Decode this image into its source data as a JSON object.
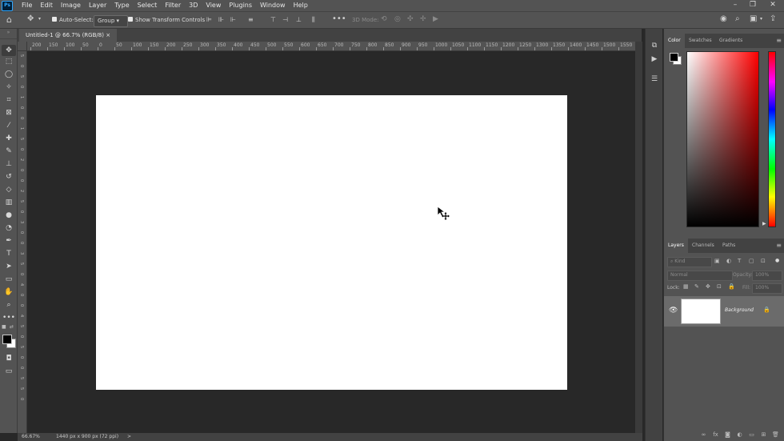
{
  "app": {
    "logo_text": "Ps"
  },
  "menubar": {
    "items": [
      "File",
      "Edit",
      "Image",
      "Layer",
      "Type",
      "Select",
      "Filter",
      "3D",
      "View",
      "Plugins",
      "Window",
      "Help"
    ],
    "window_controls": [
      "–",
      "❐",
      "✕"
    ]
  },
  "options": {
    "auto_select_label": "Auto-Select:",
    "auto_select_value": "Group",
    "show_transform_label": "Show Transform Controls",
    "mode_3d_label": "3D Mode:"
  },
  "document": {
    "tab_title": "Untitled-1 @ 66.7% (RGB/8)",
    "tab_close": "×",
    "ruler_labels": [
      "200",
      "150",
      "100",
      "50",
      "0",
      "50",
      "100",
      "150",
      "200",
      "250",
      "300",
      "350",
      "400",
      "450",
      "500",
      "550",
      "600",
      "650",
      "700",
      "750",
      "800",
      "850",
      "900",
      "950",
      "1000",
      "1050",
      "1100",
      "1150",
      "1200",
      "1250",
      "1300",
      "1350",
      "1400",
      "1450",
      "1500",
      "1550"
    ],
    "ruler_v_labels": [
      "5",
      "0",
      "5",
      "0",
      "1",
      "0",
      "0",
      "1",
      "5",
      "0",
      "2",
      "0",
      "0",
      "2",
      "5",
      "0",
      "3",
      "0",
      "0",
      "3",
      "5",
      "0",
      "4",
      "0",
      "0",
      "4",
      "5",
      "0",
      "5",
      "0",
      "0",
      "5",
      "5",
      "0"
    ]
  },
  "status": {
    "zoom": "66.67%",
    "doc_info": "1440 px x 900 px (72 ppi)",
    "arrow": ">"
  },
  "color_panel": {
    "tabs": [
      "Color",
      "Swatches",
      "Gradients"
    ],
    "active_tab": "Color",
    "fg_color": "#000000",
    "bg_color": "#ffffff",
    "hue_color": "#ff0000"
  },
  "layers_panel": {
    "tabs": [
      "Layers",
      "Channels",
      "Paths"
    ],
    "active_tab": "Layers",
    "search_placeholder": "Kind",
    "blend_mode": "Normal",
    "opacity_label": "Opacity:",
    "opacity_value": "100%",
    "lock_label": "Lock:",
    "fill_label": "Fill:",
    "fill_value": "100%",
    "layers": [
      {
        "name": "Background",
        "visible": true,
        "locked": true
      }
    ],
    "footer_icons": [
      "link-icon",
      "fx-icon",
      "mask-icon",
      "adjustment-icon",
      "group-icon",
      "new-layer-icon",
      "trash-icon"
    ],
    "footer_glyphs": [
      "∞",
      "fx",
      "◙",
      "◐",
      "▭",
      "⊞",
      "🗑"
    ]
  },
  "toolbar": {
    "tools": [
      {
        "name": "move-tool-icon",
        "glyph": "✥",
        "active": true
      },
      {
        "name": "marquee-tool-icon",
        "glyph": "⬚"
      },
      {
        "name": "lasso-tool-icon",
        "glyph": "◯"
      },
      {
        "name": "magic-wand-tool-icon",
        "glyph": "✧"
      },
      {
        "name": "crop-tool-icon",
        "glyph": "⌗"
      },
      {
        "name": "frame-tool-icon",
        "glyph": "⊠"
      },
      {
        "name": "eyedropper-tool-icon",
        "glyph": "⁄"
      },
      {
        "name": "healing-brush-tool-icon",
        "glyph": "✚"
      },
      {
        "name": "brush-tool-icon",
        "glyph": "✎"
      },
      {
        "name": "clone-stamp-tool-icon",
        "glyph": "⊥"
      },
      {
        "name": "history-brush-tool-icon",
        "glyph": "↺"
      },
      {
        "name": "eraser-tool-icon",
        "glyph": "◇"
      },
      {
        "name": "gradient-tool-icon",
        "glyph": "▥"
      },
      {
        "name": "blur-tool-icon",
        "glyph": "●"
      },
      {
        "name": "dodge-tool-icon",
        "glyph": "◔"
      },
      {
        "name": "pen-tool-icon",
        "glyph": "✒"
      },
      {
        "name": "type-tool-icon",
        "glyph": "T"
      },
      {
        "name": "path-selection-tool-icon",
        "glyph": "➤"
      },
      {
        "name": "rectangle-tool-icon",
        "glyph": "▭"
      },
      {
        "name": "hand-tool-icon",
        "glyph": "✋"
      },
      {
        "name": "zoom-tool-icon",
        "glyph": "⌕"
      },
      {
        "name": "more-tools-icon",
        "glyph": "•••"
      }
    ]
  }
}
